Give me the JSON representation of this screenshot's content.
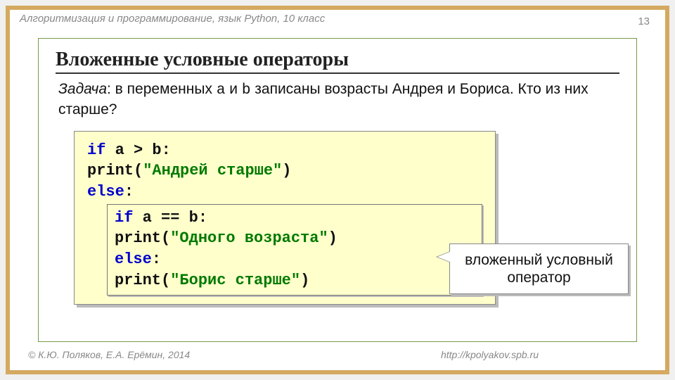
{
  "header": "Алгоритмизация и программирование, язык Python, 10 класс",
  "page_number": "13",
  "title": "Вложенные условные операторы",
  "task": {
    "label": "Задача",
    "prefix": ": в переменных ",
    "var_a": "a",
    "mid1": " и ",
    "var_b": "b",
    "suffix": " записаны возрасты Андрея и Бориса. Кто из них старше?"
  },
  "code": {
    "kw_if1": "if",
    "cond1": " a > b:",
    "print1a": "  print(",
    "str1": "\"Андрей старше\"",
    "print1b": ")",
    "kw_else1": "else",
    "colon1": ":",
    "kw_if2": "if",
    "cond2": " a == b:",
    "print2a": "  print(",
    "str2": "\"Одного возраста\"",
    "print2b": ")",
    "kw_else2": "else",
    "colon2": ":",
    "print3a": "  print(",
    "str3": "\"Борис старше\"",
    "print3b": ")"
  },
  "callout": "вложенный условный оператор",
  "footer_left": "© К.Ю. Поляков, Е.А. Ерёмин, 2014",
  "footer_right": "http://kpolyakov.spb.ru"
}
